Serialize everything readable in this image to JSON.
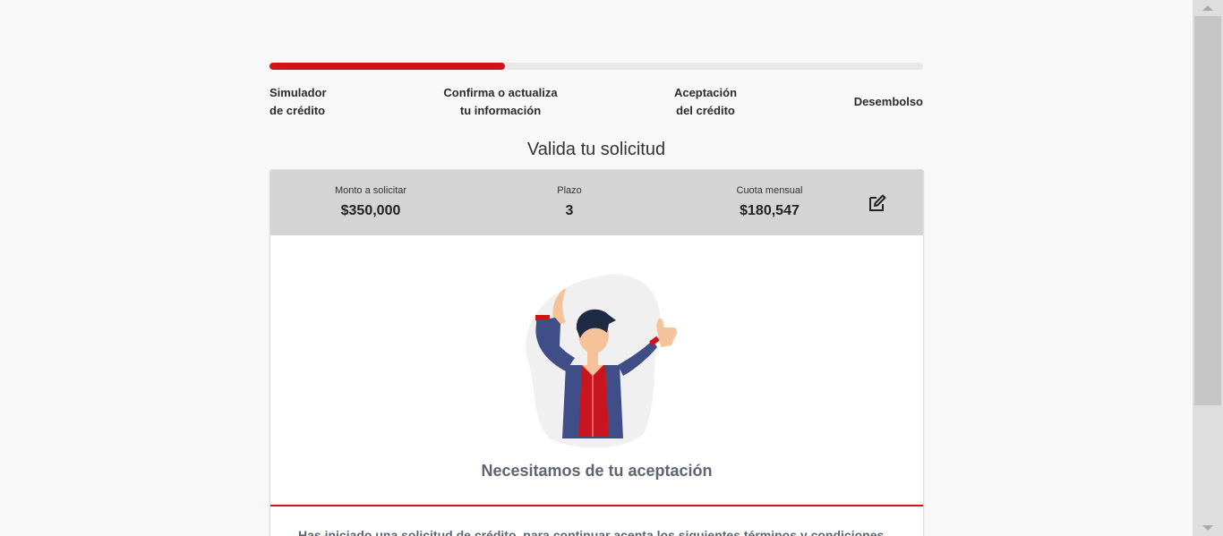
{
  "progress": {
    "completed_fraction": 0.36
  },
  "steps": [
    {
      "line1": "Simulador",
      "line2": "de crédito"
    },
    {
      "line1": "Confirma o actualiza",
      "line2": "tu información"
    },
    {
      "line1": "Aceptación",
      "line2": "del crédito"
    },
    {
      "line1": "Desembolso",
      "line2": ""
    }
  ],
  "page": {
    "title": "Valida tu solicitud"
  },
  "summary": {
    "amount_label": "Monto a solicitar",
    "amount_value": "$350,000",
    "term_label": "Plazo",
    "term_value": "3",
    "installment_label": "Cuota mensual",
    "installment_value": "$180,547",
    "edit_icon": "pencil-square-icon"
  },
  "acceptance": {
    "title": "Necesitamos de tu aceptación",
    "terms_text": "Has iniciado una solicitud de crédito, para continuar acepta los siguientes términos y condiciones"
  },
  "colors": {
    "accent": "#d0121b",
    "summary_bg": "#d4d4d4",
    "muted_text": "#5e6472"
  }
}
